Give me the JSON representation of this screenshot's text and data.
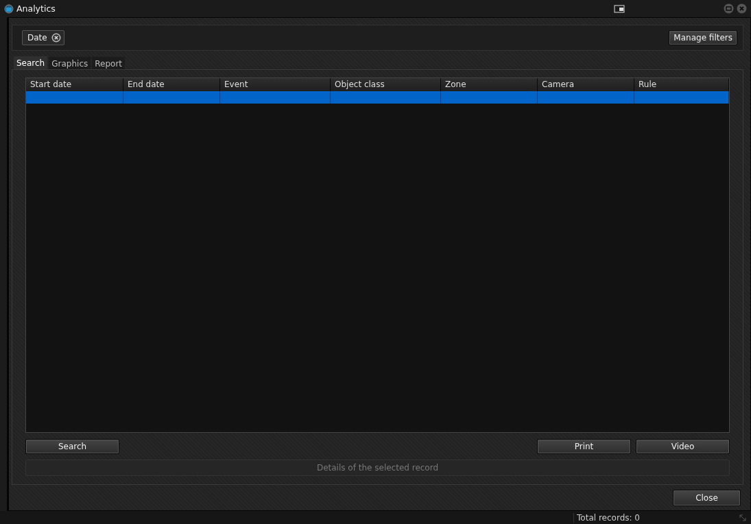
{
  "window": {
    "title": "Analytics"
  },
  "filters": {
    "chips": [
      {
        "label": "Date"
      }
    ],
    "manage_button": "Manage filters"
  },
  "tabs": [
    {
      "label": "Search",
      "selected": true
    },
    {
      "label": "Graphics",
      "selected": false
    },
    {
      "label": "Report",
      "selected": false
    }
  ],
  "table": {
    "columns": [
      "Start date",
      "End date",
      "Event",
      "Object class",
      "Zone",
      "Camera",
      "Rule"
    ],
    "rows": [
      {
        "selected": true
      }
    ]
  },
  "actions": {
    "left": [
      "Search"
    ],
    "right": [
      "Print",
      "Video"
    ]
  },
  "details": {
    "placeholder": "Details of the selected record"
  },
  "close_button": "Close",
  "status_bar": {
    "total": "Total records: 0"
  }
}
